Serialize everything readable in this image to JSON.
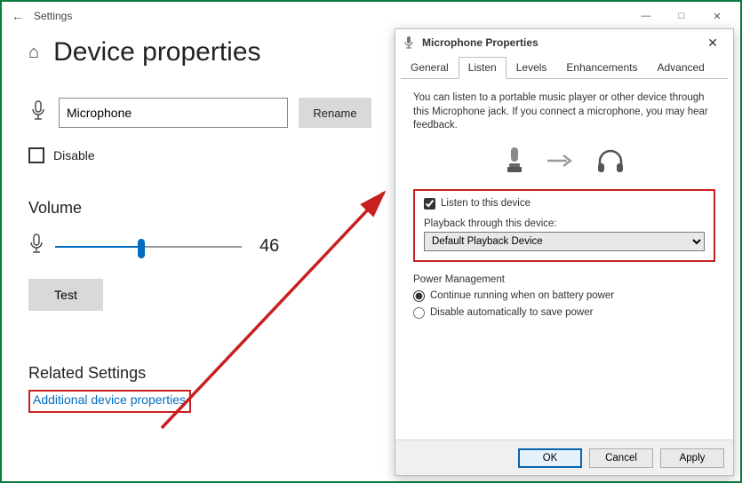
{
  "settings": {
    "window_title": "Settings",
    "page_title": "Device properties",
    "mic_name": "Microphone",
    "rename": "Rename",
    "disable": "Disable",
    "volume_label": "Volume",
    "volume_value": "46",
    "volume_percent": 46,
    "test": "Test",
    "related_heading": "Related Settings",
    "additional_link": "Additional device properties"
  },
  "dialog": {
    "title": "Microphone Properties",
    "tabs": {
      "general": "General",
      "listen": "Listen",
      "levels": "Levels",
      "enhancements": "Enhancements",
      "advanced": "Advanced"
    },
    "active_tab": "listen",
    "info": "You can listen to a portable music player or other device through this Microphone jack.  If you connect a microphone, you may hear feedback.",
    "listen_checkbox": "Listen to this device",
    "listen_checked": true,
    "playback_label": "Playback through this device:",
    "playback_value": "Default Playback Device",
    "pm_label": "Power Management",
    "pm_running": "Continue running when on battery power",
    "pm_disable": "Disable automatically to save power",
    "pm_selected": "running",
    "buttons": {
      "ok": "OK",
      "cancel": "Cancel",
      "apply": "Apply"
    }
  }
}
